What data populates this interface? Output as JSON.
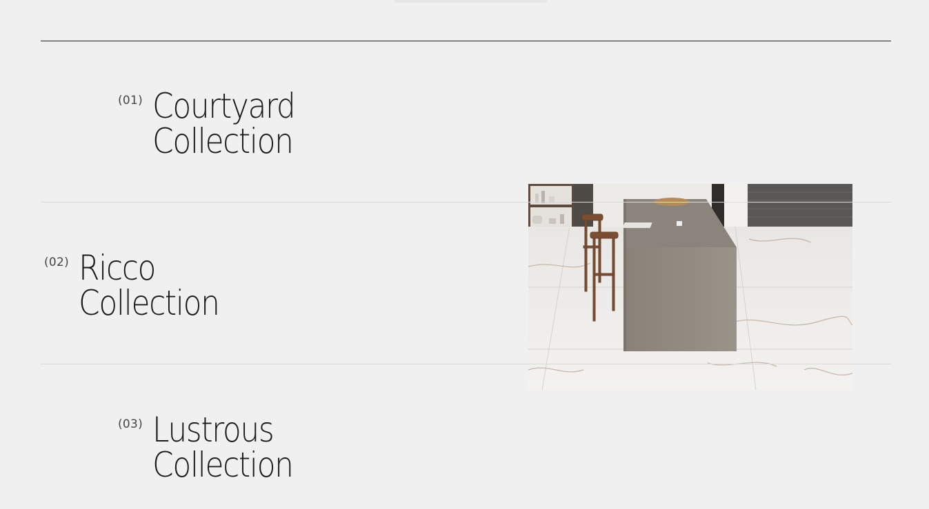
{
  "collections": [
    {
      "number": "(01)",
      "title_line1": "Courtyard",
      "title_line2": "Collection"
    },
    {
      "number": "(02)",
      "title_line1": "Ricco",
      "title_line2": "Collection"
    },
    {
      "number": "(03)",
      "title_line1": "Lustrous",
      "title_line2": "Collection"
    }
  ],
  "preview": {
    "active_collection_index": 1
  },
  "colors": {
    "background": "#f0f0f0",
    "text": "#1a1a1a",
    "rule_dark": "#1a1a1a",
    "rule_light": "#d9d9d9"
  }
}
